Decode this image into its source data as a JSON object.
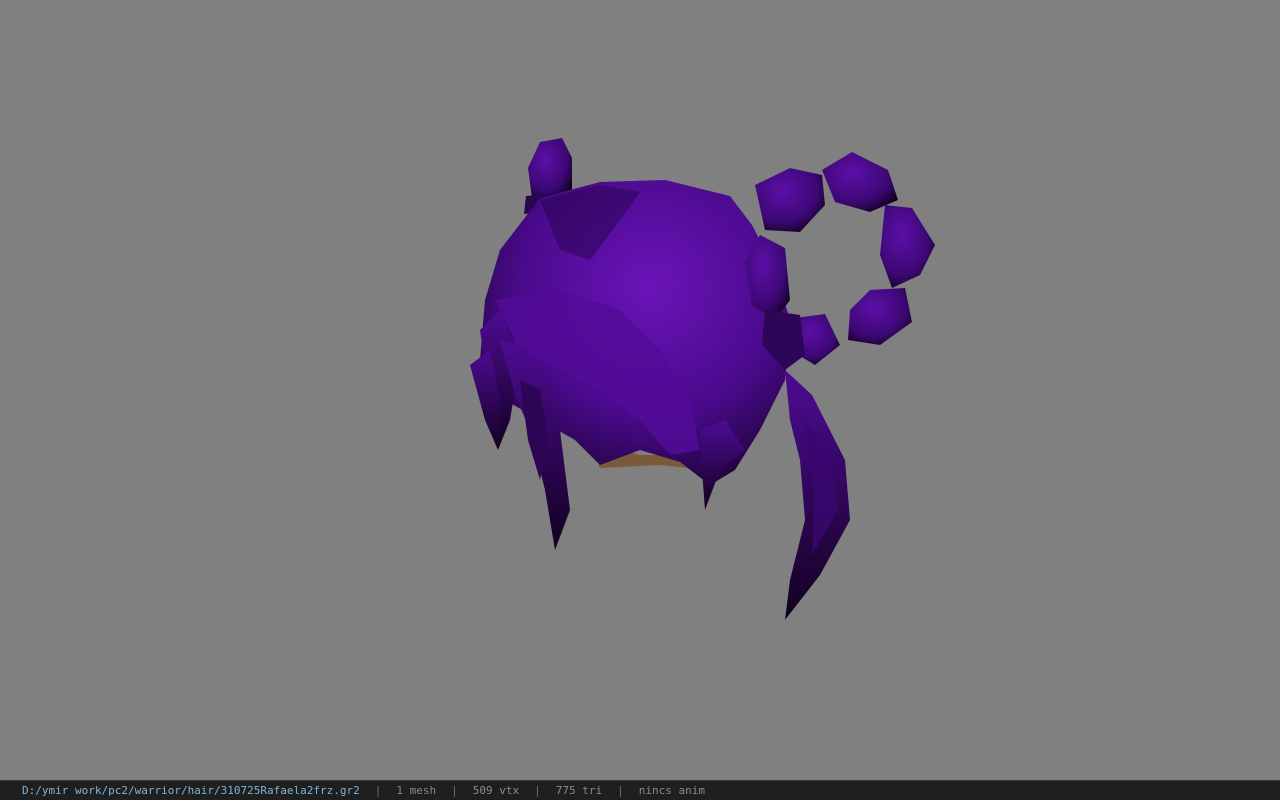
{
  "viewer": {
    "background_color": "#808080",
    "hair_color": "#4a0a8c",
    "model_icon": "purple-hair-mesh"
  },
  "statusbar": {
    "file_path": "D:/ymir work/pc2/warrior/hair/310725Rafaela2frz.gr2",
    "separator": "|",
    "mesh_count": "1 mesh",
    "vertex_count": "509 vtx",
    "triangle_count": "775 tri",
    "anim_status": "nincs anim"
  }
}
